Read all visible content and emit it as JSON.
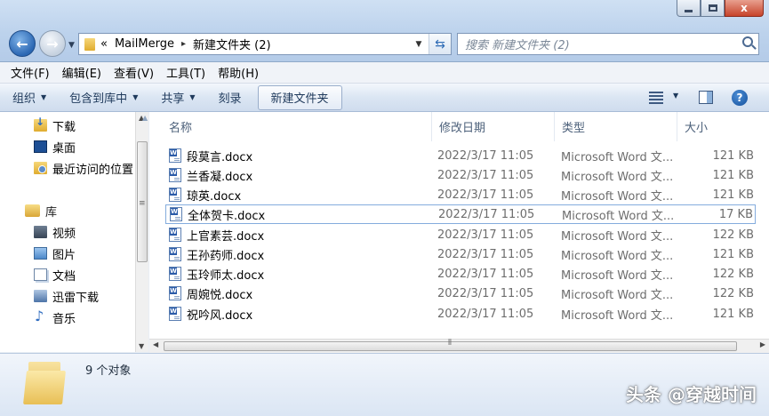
{
  "window": {
    "buttons": [
      "minimize-button",
      "maximize-button",
      "close-button"
    ],
    "close_glyph": "x"
  },
  "nav": {
    "back_glyph": "←",
    "forward_glyph": "→"
  },
  "address": {
    "overflow_glyph": "«",
    "segments": [
      "MailMerge",
      "新建文件夹 (2)"
    ],
    "separator": "▸"
  },
  "search": {
    "placeholder": "搜索 新建文件夹 (2)"
  },
  "menu": [
    "文件(F)",
    "编辑(E)",
    "查看(V)",
    "工具(T)",
    "帮助(H)"
  ],
  "toolbar": {
    "organize": "组织",
    "include_in_library": "包含到库中",
    "share": "共享",
    "burn": "刻录",
    "new_folder": "新建文件夹",
    "help_glyph": "?"
  },
  "sidebar": {
    "favorites": [
      {
        "label": "下载",
        "icon": "download-folder-icon"
      },
      {
        "label": "桌面",
        "icon": "desktop-icon"
      },
      {
        "label": "最近访问的位置",
        "icon": "recent-places-icon"
      }
    ],
    "library_label": "库",
    "libraries": [
      {
        "label": "视频",
        "icon": "video-library-icon"
      },
      {
        "label": "图片",
        "icon": "picture-library-icon"
      },
      {
        "label": "文档",
        "icon": "document-library-icon"
      },
      {
        "label": "迅雷下载",
        "icon": "thunder-download-icon"
      },
      {
        "label": "音乐",
        "icon": "music-library-icon"
      }
    ]
  },
  "columns": {
    "name": "名称",
    "date": "修改日期",
    "type": "类型",
    "size": "大小"
  },
  "files": [
    {
      "name": "段莫言.docx",
      "date": "2022/3/17 11:05",
      "type": "Microsoft Word 文...",
      "size": "121 KB"
    },
    {
      "name": "兰香凝.docx",
      "date": "2022/3/17 11:05",
      "type": "Microsoft Word 文...",
      "size": "121 KB"
    },
    {
      "name": "琼英.docx",
      "date": "2022/3/17 11:05",
      "type": "Microsoft Word 文...",
      "size": "121 KB"
    },
    {
      "name": "全体贺卡.docx",
      "date": "2022/3/17 11:05",
      "type": "Microsoft Word 文...",
      "size": "17 KB",
      "selected": true
    },
    {
      "name": "上官素芸.docx",
      "date": "2022/3/17 11:05",
      "type": "Microsoft Word 文...",
      "size": "122 KB"
    },
    {
      "name": "王孙药师.docx",
      "date": "2022/3/17 11:05",
      "type": "Microsoft Word 文...",
      "size": "121 KB"
    },
    {
      "name": "玉玲师太.docx",
      "date": "2022/3/17 11:05",
      "type": "Microsoft Word 文...",
      "size": "122 KB"
    },
    {
      "name": "周婉悦.docx",
      "date": "2022/3/17 11:05",
      "type": "Microsoft Word 文...",
      "size": "122 KB"
    },
    {
      "name": "祝吟风.docx",
      "date": "2022/3/17 11:05",
      "type": "Microsoft Word 文...",
      "size": "121 KB"
    }
  ],
  "details": {
    "count": "9 个对象"
  },
  "watermark": "头条 @穿越时间",
  "colors": {
    "accent": "#2b67b3",
    "selection_border": "#84acdd"
  }
}
